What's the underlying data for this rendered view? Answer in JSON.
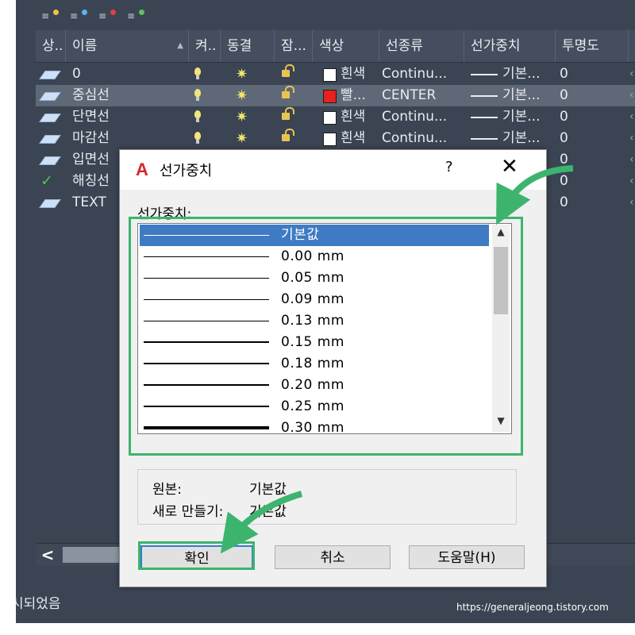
{
  "layers": {
    "columns": [
      {
        "label": "상.."
      },
      {
        "label": "이름"
      },
      {
        "label": "켜.."
      },
      {
        "label": "동결"
      },
      {
        "label": "잠..."
      },
      {
        "label": "색상"
      },
      {
        "label": "선종류"
      },
      {
        "label": "선가중치"
      },
      {
        "label": "투명도"
      }
    ],
    "rows": [
      {
        "name": "0",
        "color_name": "흰색",
        "color_hex": "#ffffff",
        "linetype": "Continu...",
        "lineweight": "기본...",
        "transparency": "0",
        "current": false,
        "selected": false
      },
      {
        "name": "중심선",
        "color_name": "빨...",
        "color_hex": "#e8201e",
        "linetype": "CENTER",
        "lineweight": "기본...",
        "transparency": "0",
        "current": false,
        "selected": true
      },
      {
        "name": "단면선",
        "color_name": "흰색",
        "color_hex": "#ffffff",
        "linetype": "Continu...",
        "lineweight": "기본...",
        "transparency": "0",
        "current": false,
        "selected": false
      },
      {
        "name": "마감선",
        "color_name": "흰색",
        "color_hex": "#ffffff",
        "linetype": "Continu...",
        "lineweight": "기본...",
        "transparency": "0",
        "current": false,
        "selected": false
      },
      {
        "name": "입면선",
        "color_name": "",
        "color_hex": "",
        "linetype": "",
        "lineweight": "",
        "transparency": "0",
        "current": false,
        "selected": false
      },
      {
        "name": "해칭선",
        "color_name": "",
        "color_hex": "",
        "linetype": "",
        "lineweight": "",
        "transparency": "0",
        "current": true,
        "selected": false
      },
      {
        "name": "TEXT",
        "color_name": "",
        "color_hex": "",
        "linetype": "",
        "lineweight": "",
        "transparency": "0",
        "current": false,
        "selected": false
      }
    ],
    "hscroll_left": "<",
    "status_text": "시되었음",
    "watermark": "https://generaljeong.tistory.com"
  },
  "dialog": {
    "title": "선가중치",
    "logo_glyph": "A",
    "help_glyph": "?",
    "close_glyph": "✕",
    "list_label": "선가중치:",
    "lineweights": [
      {
        "label": "기본값",
        "selected": true
      },
      {
        "label": "0.00 mm"
      },
      {
        "label": "0.05 mm"
      },
      {
        "label": "0.09 mm"
      },
      {
        "label": "0.13 mm"
      },
      {
        "label": "0.15 mm"
      },
      {
        "label": "0.18 mm"
      },
      {
        "label": "0.20 mm"
      },
      {
        "label": "0.25 mm"
      },
      {
        "label": "0.30 mm"
      }
    ],
    "original_label": "원본:",
    "original_value": "기본값",
    "new_label": "새로 만들기:",
    "new_value": "기본값",
    "ok_label": "확인",
    "cancel_label": "취소",
    "help_label": "도움말(H)"
  },
  "colors": {
    "background": "#3b4453",
    "accent_green": "#3cb46e",
    "selection_blue": "#3e7bc4"
  }
}
